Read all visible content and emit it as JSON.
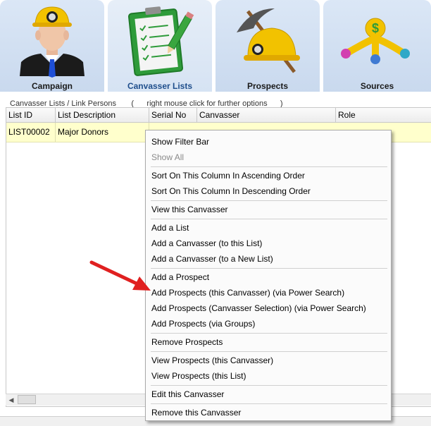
{
  "tabs": [
    {
      "label": "Campaign",
      "icon": "miner-person-icon",
      "active": false
    },
    {
      "label": "Canvasser Lists",
      "icon": "clipboard-checklist-icon",
      "active": true
    },
    {
      "label": "Prospects",
      "icon": "pickaxe-helmet-icon",
      "active": false
    },
    {
      "label": "Sources",
      "icon": "dollar-sources-icon",
      "active": false
    }
  ],
  "section": {
    "caption": "Canvasser Lists / Link Persons       (      right mouse click for further options      )"
  },
  "table": {
    "columns": [
      "List ID",
      "List Description",
      "Serial No",
      "Canvasser",
      "Role"
    ],
    "rows": [
      {
        "list_id": "LIST00002",
        "description": "Major Donors"
      }
    ]
  },
  "context_menu": {
    "items": [
      {
        "label": "Show Filter Bar",
        "enabled": true
      },
      {
        "label": "Show All",
        "enabled": false
      },
      {
        "label": "Sort On This Column In Ascending Order",
        "enabled": true
      },
      {
        "label": "Sort On This Column In Descending Order",
        "enabled": true
      },
      {
        "label": "View this Canvasser",
        "enabled": true
      },
      {
        "label": "Add a List",
        "enabled": true
      },
      {
        "label": "Add a Canvasser (to this List)",
        "enabled": true
      },
      {
        "label": "Add a Canvasser (to a New List)",
        "enabled": true
      },
      {
        "label": "Add a Prospect",
        "enabled": true
      },
      {
        "label": "Add Prospects (this Canvasser) (via Power Search)",
        "enabled": true
      },
      {
        "label": "Add Prospects (Canvasser Selection) (via Power Search)",
        "enabled": true
      },
      {
        "label": "Add Prospects (via Groups)",
        "enabled": true
      },
      {
        "label": "Remove Prospects",
        "enabled": true
      },
      {
        "label": "View Prospects (this Canvasser)",
        "enabled": true
      },
      {
        "label": "View Prospects (this List)",
        "enabled": true
      },
      {
        "label": "Edit this Canvasser",
        "enabled": true
      },
      {
        "label": "Remove this Canvasser",
        "enabled": true
      }
    ]
  },
  "annotation": {
    "arrow_color": "#e02020",
    "points_to": "Add Prospects (this Canvasser) (via Power Search)"
  },
  "colors": {
    "selected_row": "#ffffcc",
    "active_tab_label": "#1f4e8c",
    "tile_bg": "#c9d9ee"
  }
}
